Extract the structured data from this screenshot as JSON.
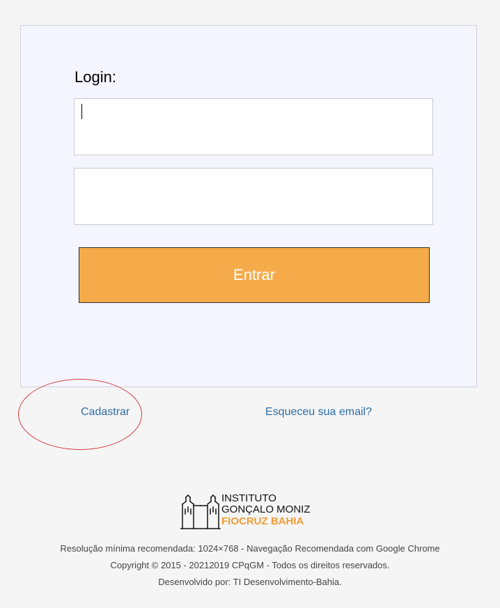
{
  "login_form": {
    "title": "Login:",
    "login_value": "",
    "password_value": "",
    "submit_label": "Entrar"
  },
  "links": {
    "register_label": "Cadastrar",
    "forgot_label": "Esqueceu sua email?"
  },
  "logo": {
    "line_1": "INSTITUTO",
    "line_2": "GONÇALO MONIZ",
    "line_3": "FIOCRUZ BAHIA"
  },
  "footer": {
    "line_1": "Resolução mínima recomendada: 1024×768 - Navegação Recomendada com Google Chrome",
    "line_2": "Copyright © 2015 - 20212019 CPqGM - Todos os direitos reservados.",
    "line_3": "Desenvolvido por: TI Desenvolvimento-Bahia."
  },
  "colors": {
    "background": "#f5f5f5",
    "panel": "#f4f5ff",
    "button": "#f6ab4a",
    "link": "#2e6da4",
    "annotation": "#d53b3b",
    "logo_accent": "#f39c34"
  },
  "icons": {
    "logo": "institute-building-icon"
  }
}
